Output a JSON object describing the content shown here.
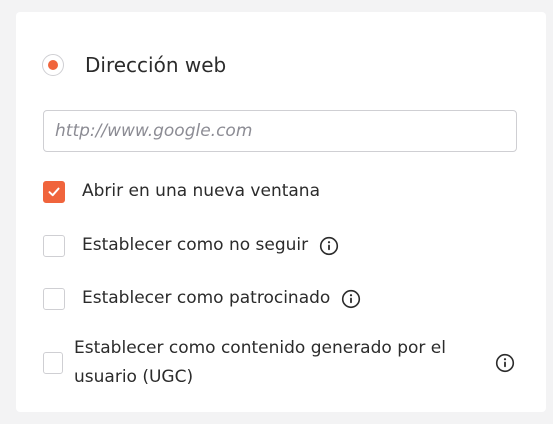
{
  "link_type": {
    "selected_option_label": "Dirección web"
  },
  "url_field": {
    "placeholder": "http://www.google.com",
    "value": ""
  },
  "options": [
    {
      "label": "Abrir en una nueva ventana",
      "checked": true,
      "info_icon": false
    },
    {
      "label": "Establecer como no seguir",
      "checked": false,
      "info_icon": true
    },
    {
      "label": "Establecer como patrocinado",
      "checked": false,
      "info_icon": true
    },
    {
      "label": "Establecer como contenido generado por el usuario (UGC)",
      "checked": false,
      "info_icon": true
    }
  ],
  "colors": {
    "accent": "#f0643c",
    "border": "#cfcfd3",
    "background": "#f3f3f4",
    "panel": "#ffffff",
    "text": "#2b2b2b",
    "placeholder": "#8c8c94"
  },
  "icons": {
    "info": "info-circle-icon",
    "check": "checkmark-icon"
  }
}
